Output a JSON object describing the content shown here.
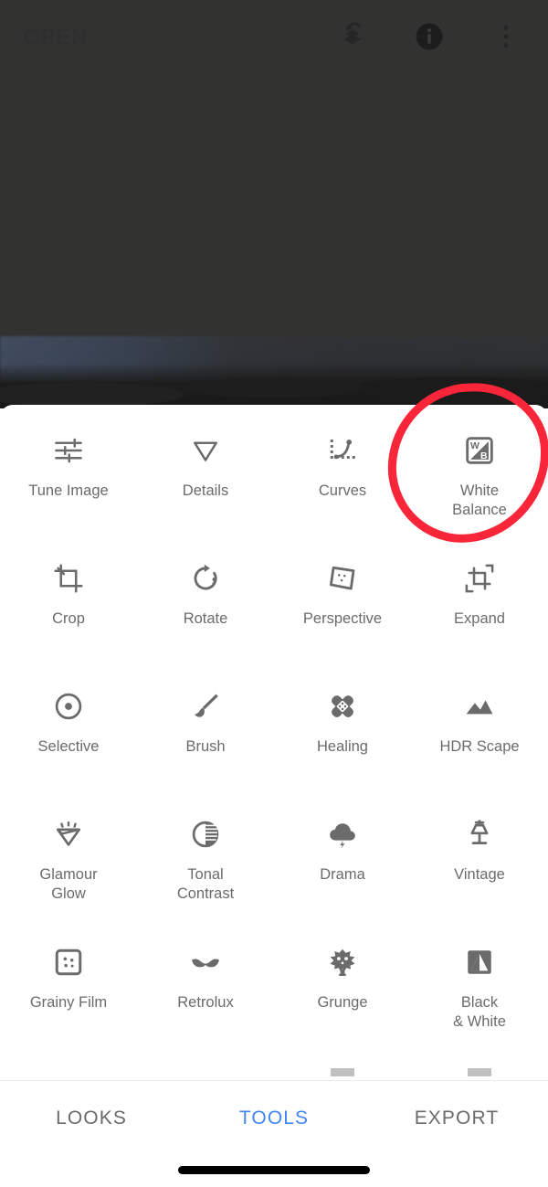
{
  "app": {
    "accent_color": "#4285f4",
    "annotation_color": "#f9263a",
    "icon_color": "#6b6b6b",
    "label_color": "#6b6b6b"
  },
  "topbar": {
    "open_label": "OPEN",
    "actions": [
      {
        "name": "revert-stacks-icon",
        "label": "Revert"
      },
      {
        "name": "info-icon",
        "label": "Info"
      },
      {
        "name": "overflow-menu-icon",
        "label": "More options"
      }
    ]
  },
  "preview": {
    "alt": "Dimmed landscape photo preview"
  },
  "tools": [
    {
      "label": "Tune Image",
      "icon": "tune-image-icon"
    },
    {
      "label": "Details",
      "icon": "details-icon"
    },
    {
      "label": "Curves",
      "icon": "curves-icon"
    },
    {
      "label": "White\nBalance",
      "icon": "white-balance-icon",
      "highlighted": true
    },
    {
      "label": "Crop",
      "icon": "crop-icon"
    },
    {
      "label": "Rotate",
      "icon": "rotate-icon"
    },
    {
      "label": "Perspective",
      "icon": "perspective-icon"
    },
    {
      "label": "Expand",
      "icon": "expand-icon"
    },
    {
      "label": "Selective",
      "icon": "selective-icon"
    },
    {
      "label": "Brush",
      "icon": "brush-icon"
    },
    {
      "label": "Healing",
      "icon": "healing-icon"
    },
    {
      "label": "HDR Scape",
      "icon": "hdr-scape-icon"
    },
    {
      "label": "Glamour\nGlow",
      "icon": "glamour-glow-icon"
    },
    {
      "label": "Tonal\nContrast",
      "icon": "tonal-contrast-icon"
    },
    {
      "label": "Drama",
      "icon": "drama-icon"
    },
    {
      "label": "Vintage",
      "icon": "vintage-icon"
    },
    {
      "label": "Grainy Film",
      "icon": "grainy-film-icon"
    },
    {
      "label": "Retrolux",
      "icon": "retrolux-icon"
    },
    {
      "label": "Grunge",
      "icon": "grunge-icon"
    },
    {
      "label": "Black\n& White",
      "icon": "black-and-white-icon"
    }
  ],
  "bottom_nav": {
    "tabs": [
      {
        "label": "LOOKS",
        "active": false
      },
      {
        "label": "TOOLS",
        "active": true
      },
      {
        "label": "EXPORT",
        "active": false
      }
    ]
  },
  "annotation": {
    "shape": "circle",
    "targets": "White Balance",
    "color": "#f9263a"
  }
}
